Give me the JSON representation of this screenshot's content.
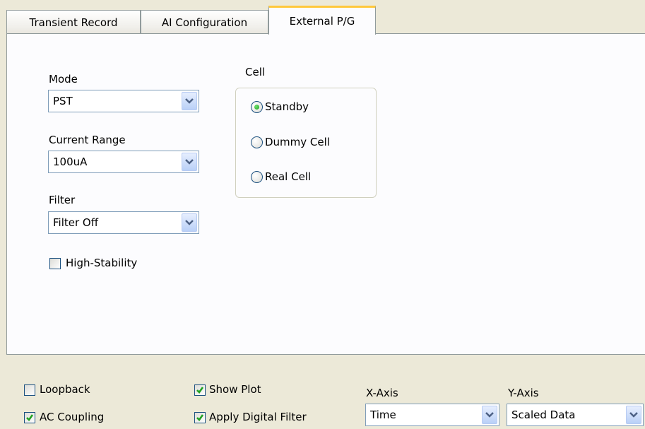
{
  "tabs": [
    {
      "label": "Transient Record",
      "active": false
    },
    {
      "label": "AI Configuration",
      "active": false
    },
    {
      "label": "External P/G",
      "active": true
    }
  ],
  "mode": {
    "label": "Mode",
    "value": "PST"
  },
  "current_range": {
    "label": "Current Range",
    "value": "100uA"
  },
  "filter": {
    "label": "Filter",
    "value": "Filter Off"
  },
  "high_stability": {
    "label": "High-Stability",
    "checked": false
  },
  "cell": {
    "label": "Cell",
    "options": [
      {
        "label": "Standby",
        "selected": true
      },
      {
        "label": "Dummy Cell",
        "selected": false
      },
      {
        "label": "Real Cell",
        "selected": false
      }
    ]
  },
  "bottom": {
    "loopback": {
      "label": "Loopback",
      "checked": false
    },
    "ac_coupling": {
      "label": "AC Coupling",
      "checked": true
    },
    "show_plot": {
      "label": "Show Plot",
      "checked": true
    },
    "apply_digital_filter": {
      "label": "Apply Digital Filter",
      "checked": true
    },
    "x_axis": {
      "label": "X-Axis",
      "value": "Time"
    },
    "y_axis": {
      "label": "Y-Axis",
      "value": "Scaled Data"
    }
  },
  "colors": {
    "background": "#ECE9D8",
    "panel": "#FCFCFE",
    "active_tab_accent": "#FFC83C",
    "check_mark": "#21A121"
  }
}
